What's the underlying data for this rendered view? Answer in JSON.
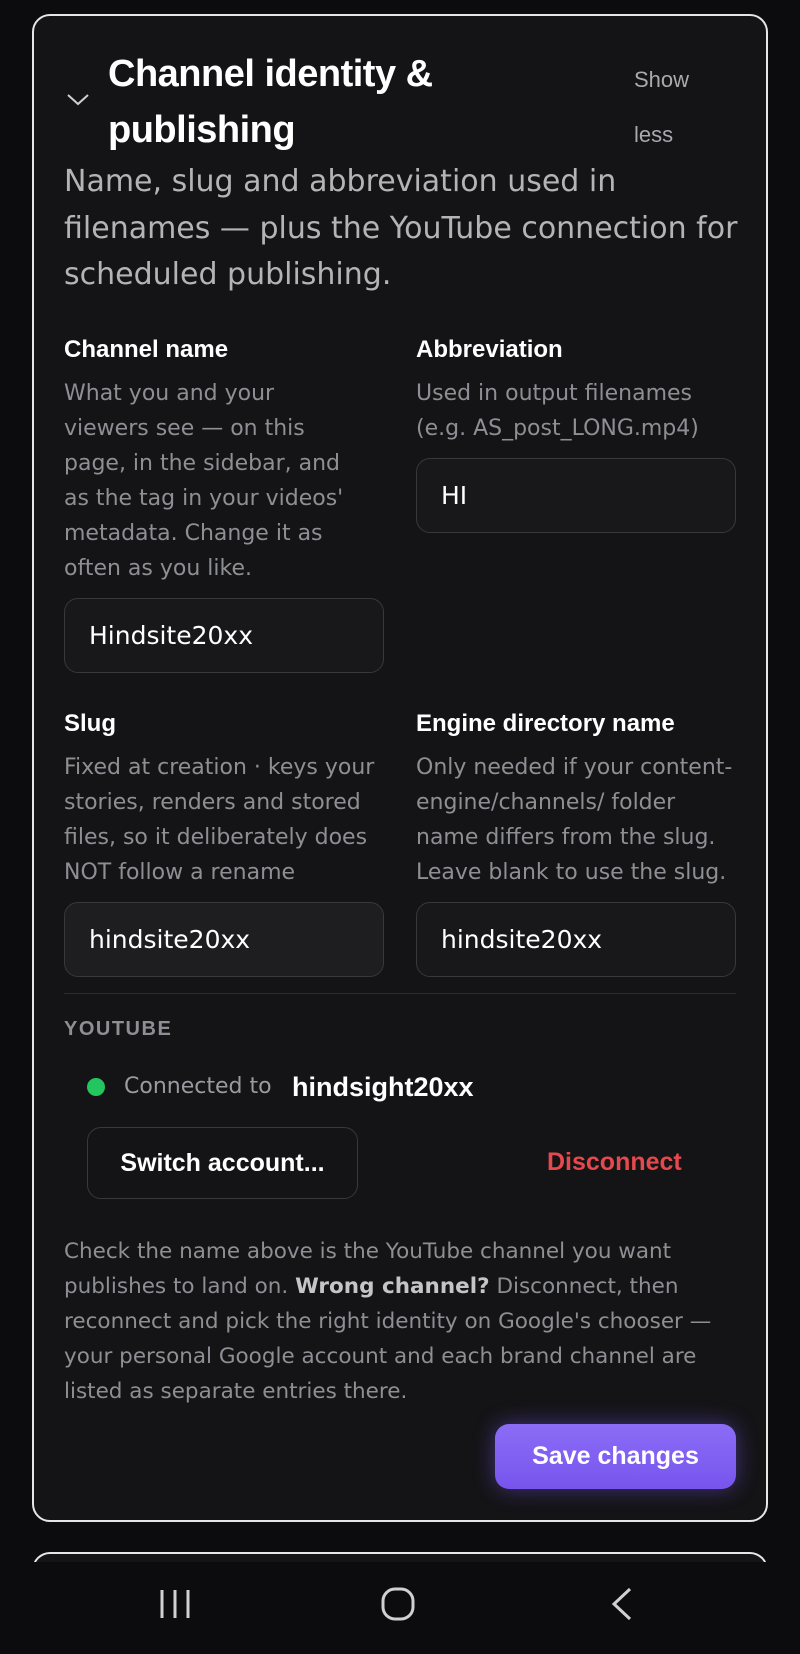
{
  "card": {
    "title": "Channel identity & publishing",
    "toggle_label": "Show less",
    "description": "Name, slug and abbreviation used in filenames — plus the YouTube connection for scheduled publishing."
  },
  "fields": {
    "channel_name": {
      "label": "Channel name",
      "hint": "What you and your viewers see — on this page, in the sidebar, and as the tag in your videos' metadata. Change it as often as you like.",
      "value": "Hindsite20xx"
    },
    "abbreviation": {
      "label": "Abbreviation",
      "hint": "Used in output filenames (e.g. AS_post_LONG.mp4)",
      "value": "HI"
    },
    "slug": {
      "label": "Slug",
      "hint": "Fixed at creation · keys your stories, renders and stored files, so it deliberately does NOT follow a rename",
      "value": "hindsite20xx"
    },
    "engine_dir": {
      "label": "Engine directory name",
      "hint": "Only needed if your content-engine/channels/ folder name differs from the slug. Leave blank to use the slug.",
      "value": "hindsite20xx"
    }
  },
  "youtube": {
    "section_label": "YOUTUBE",
    "status_text": "Connected to",
    "account_name": "hindsight20xx",
    "status_color": "#22c55e",
    "switch_label": "Switch account...",
    "disconnect_label": "Disconnect",
    "help_lead": "Check the name above is the YouTube channel you want publishes to land on.",
    "help_bold": "Wrong channel?",
    "help_tail": "Disconnect, then reconnect and pick the right identity on Google's chooser — your personal Google account and each brand channel are listed as separate entries there."
  },
  "actions": {
    "save_label": "Save changes"
  },
  "colors": {
    "accent": "#7c5cf6",
    "danger": "#e5484d",
    "background": "#0c0c0e"
  },
  "navbar": {
    "icons": [
      "recent-apps-icon",
      "home-icon",
      "back-icon"
    ]
  }
}
